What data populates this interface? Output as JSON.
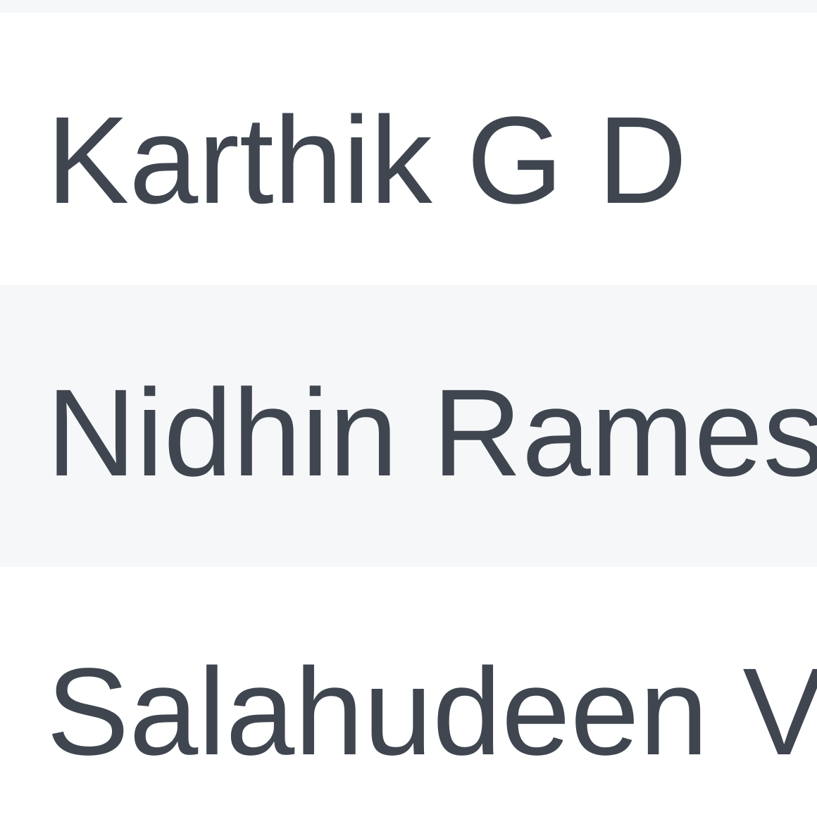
{
  "table": {
    "rows": [
      {
        "name": "Karthik G D"
      },
      {
        "name": "Nidhin Ramesh"
      },
      {
        "name": "Salahudeen V"
      }
    ]
  },
  "colors": {
    "text": "#3f4650",
    "row_alt_background": "#f6f7f9",
    "row_background": "#ffffff"
  }
}
